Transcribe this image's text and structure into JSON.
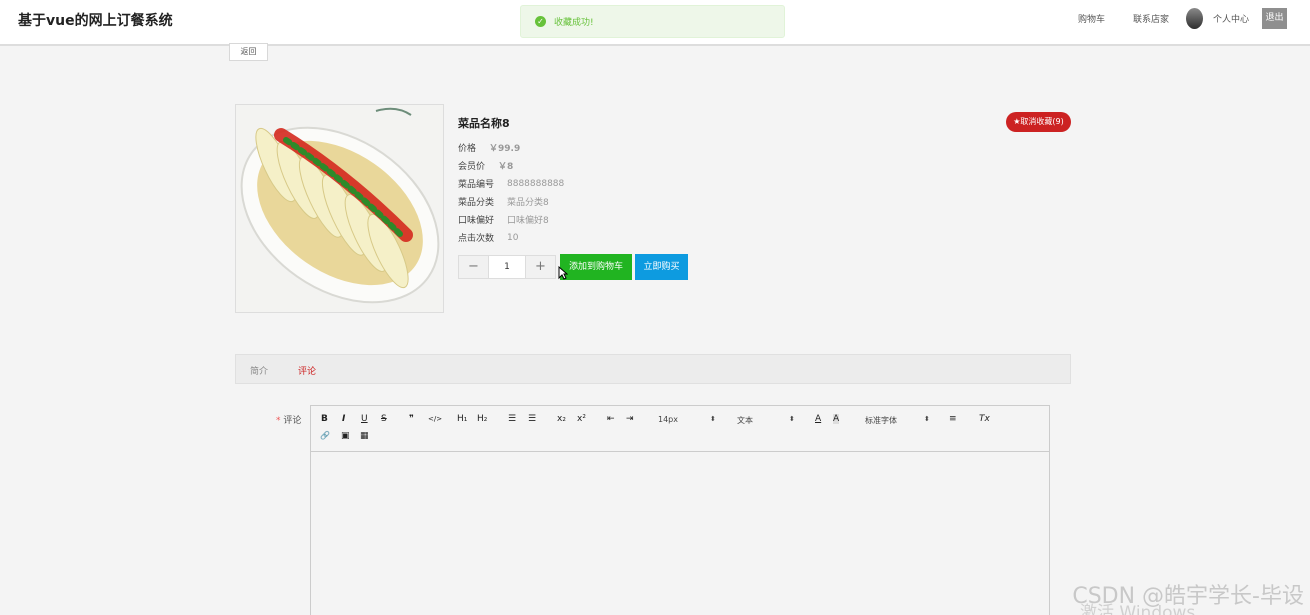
{
  "header": {
    "brand": "基于vue的网上订餐系统",
    "nav": {
      "cart": "购物车",
      "contact": "联系店家",
      "profile": "个人中心",
      "logout": "退出"
    }
  },
  "toast": {
    "message": "收藏成功!",
    "icon": "check-circle-icon",
    "color": "#67c23a"
  },
  "back_label": "返回",
  "product": {
    "name": "菜品名称8",
    "fav_button": "★取消收藏(9)",
    "price_label": "价格",
    "price": "￥99.9",
    "vip_label": "会员价",
    "vip_price": "￥8",
    "code_label": "菜品编号",
    "code": "8888888888",
    "category_label": "菜品分类",
    "category": "菜品分类8",
    "taste_label": "口味偏好",
    "taste": "口味偏好8",
    "clicks_label": "点击次数",
    "clicks": "10",
    "quantity": "1",
    "minus": "−",
    "plus": "+",
    "add_cart": "添加到购物车",
    "buy_now": "立即购买"
  },
  "tabs": [
    {
      "label": "简介",
      "active": false
    },
    {
      "label": "评论",
      "active": true
    }
  ],
  "comment": {
    "required_mark": "*",
    "label": "评论",
    "toolbar": {
      "bold": "B",
      "italic": "I",
      "underline": "U",
      "strike": "S",
      "quote": "❞",
      "code": "</>",
      "h1": "H₁",
      "h2": "H₂",
      "ordered_list": "☰",
      "bullet_list": "☰",
      "sub": "x₂",
      "sup": "x²",
      "outdent": "⇤",
      "indent": "⇥",
      "size_value": "14px",
      "text_value": "文本",
      "font_value": "标准字体",
      "color": "A",
      "background": "A",
      "align": "≡",
      "clean": "Tx",
      "link": "🔗",
      "image": "▣",
      "video": "▦"
    }
  },
  "watermark": "CSDN @皓宇学长-毕设",
  "windows_text": "激活 Windows",
  "colors": {
    "accent_red": "#cc2222",
    "green": "#21b421",
    "blue": "#0d9be0"
  }
}
